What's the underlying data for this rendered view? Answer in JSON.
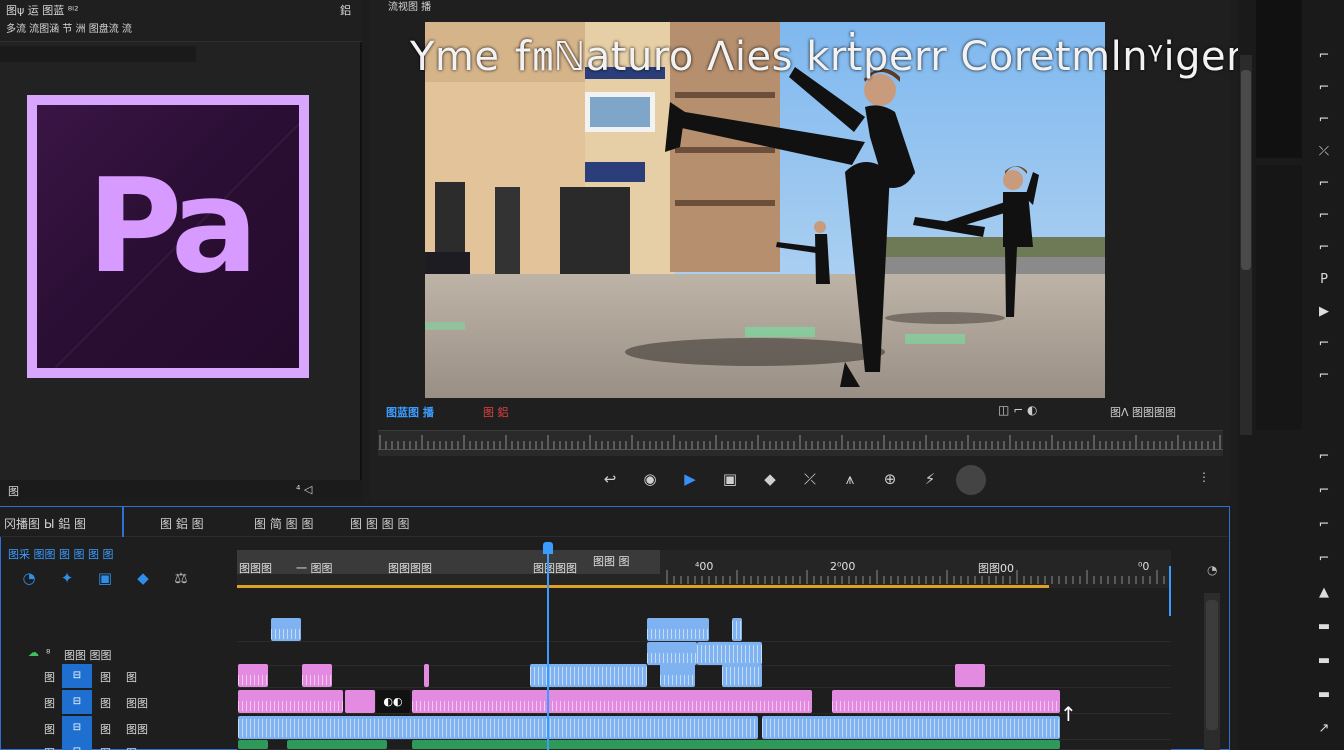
{
  "left_panel": {
    "header_line1": "图ψ 运 图蓝 ⁸ⁱ²",
    "header_line2": "多流 流图涵 节 洲 图盘流 流",
    "header_line3": "鋁",
    "logo_letters": "Pa",
    "footer_left": "图",
    "footer_right": "⁴ ◁ "
  },
  "monitor": {
    "header_label": "流视图 播",
    "overlay_title": "Yme ㎙ℕaturo Ʌies krṫperr Coretmlnᵞigem",
    "timecode_left": "图蓝图 播",
    "timecode_red": "图 鋁",
    "timecode_right": "图Λ 图图图图",
    "right_icons": "◫ ⌐ ◐",
    "transport": [
      "↩",
      "◉",
      "▶",
      "▣",
      "◆",
      "⤫",
      "⩚",
      "⊕",
      "⚡"
    ]
  },
  "timeline": {
    "tabs": [
      "冈播图 Ы 鋁 图",
      "图 鋁 图",
      "图 简 图 图",
      "图 图 图 图"
    ],
    "sub_label": "图采 图图 图 图 图 图",
    "tools": [
      "◔",
      "✦",
      "▣",
      "◆",
      "⚖"
    ],
    "ruler_labels": [
      "图图图",
      "一 图图",
      "图图图图",
      "图图图图",
      "图图 图",
      "⁴00",
      "2⁰00",
      "图图00",
      "⁰0"
    ],
    "tracks": [
      {
        "name": "⁸",
        "label": "图图 图图",
        "eye": true
      },
      {
        "name": "图",
        "sq": "⊟",
        "label": "图",
        "label2": "图"
      },
      {
        "name": "图",
        "sq": "⊟",
        "label": "图",
        "label2": "图图"
      },
      {
        "name": "图",
        "sq": "⊟",
        "label": "图",
        "label2": "图图"
      },
      {
        "name": "图",
        "sq": "⊟",
        "label": "图",
        "label2": "图"
      }
    ],
    "clip_badge": "◐◐"
  },
  "right_strip": {
    "icons_top": [
      "⌐",
      "⌐",
      "⌐",
      "⤫",
      "⌐",
      "⌐",
      "⌐",
      "P",
      "▶",
      "⌐",
      "⌐"
    ],
    "icons_bottom": [
      "⌐",
      "⌐",
      "⌐",
      "⌐",
      "▲",
      "▬",
      "▬",
      "▬",
      "↗"
    ]
  },
  "colors": {
    "accent": "#3b9cff",
    "premiere_purple": "#d79aff",
    "clip_pink": "#e28be0",
    "clip_blue": "#7fb2f0",
    "clip_green": "#2f9a58"
  }
}
